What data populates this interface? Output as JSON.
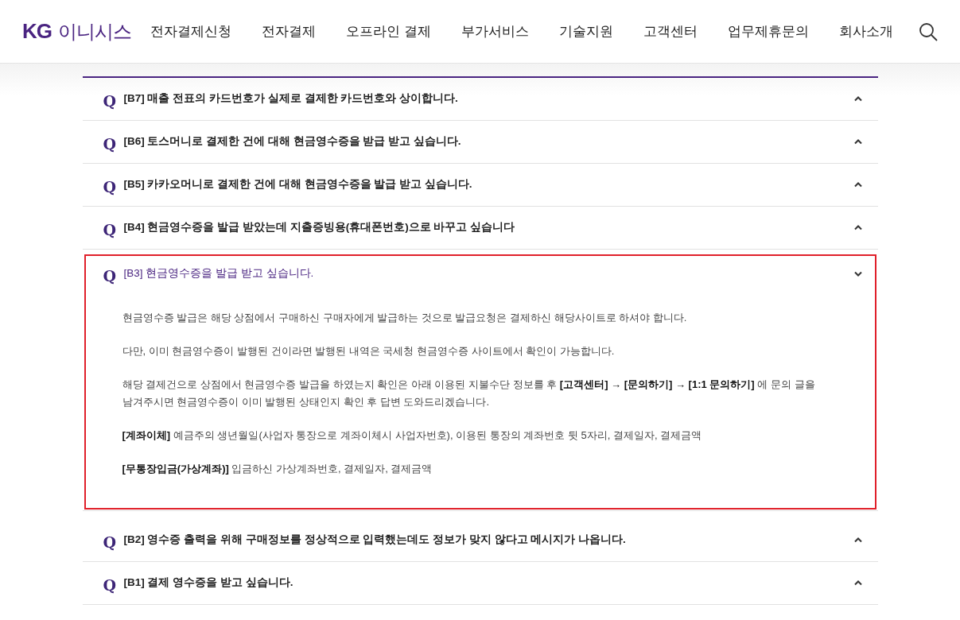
{
  "header": {
    "logo": {
      "mark": "KG",
      "name": "이니시스"
    },
    "nav": [
      "전자결제신청",
      "전자결제",
      "오프라인 결제",
      "부가서비스",
      "기술지원",
      "고객센터",
      "업무제휴문의",
      "회사소개"
    ]
  },
  "faq": [
    {
      "q": "Q",
      "title": "[B7] 매출 전표의 카드번호가 실제로 결제한 카드번호와 상이합니다.",
      "expanded": false
    },
    {
      "q": "Q",
      "title": "[B6] 토스머니로 결제한 건에 대해 현금영수증을 받급 받고 싶습니다.",
      "expanded": false
    },
    {
      "q": "Q",
      "title": "[B5] 카카오머니로 결제한 건에 대해 현금영수증을 발급 받고 싶습니다.",
      "expanded": false
    },
    {
      "q": "Q",
      "title": "[B4] 현금영수증을 발급 받았는데 지출증빙용(휴대폰번호)으로 바꾸고 싶습니다",
      "expanded": false
    },
    {
      "q": "Q",
      "title": "[B3] 현금영수증을 발급 받고 싶습니다.",
      "expanded": true,
      "answer": [
        "현금영수증 발급은 해당 상점에서 구매하신 구매자에게 발급하는 것으로 발급요청은 결제하신 해당사이트로 하셔야 합니다.",
        "다만, 이미 현금영수증이 발행된 건이라면 발행된 내역은 국세청 현금영수증 사이트에서 확인이 가능합니다.",
        "해당 결제건으로 상점에서 현금영수증 발급을 하였는지 확인은 아래 이용된 지불수단 정보를 후 **[고객센터] → [문의하기] → [1:1 문의하기]** 에 문의 글을 남겨주시면 현금영수증이 이미 발행된 상태인지 확인 후 답변 도와드리겠습니다.",
        "**[계좌이체]** 예금주의 생년월일(사업자 통장으로 계좌이체시 사업자번호), 이용된 통장의 계좌번호 뒷 5자리, 결제일자, 결제금액",
        "**[무통장입금(가상계좌)]** 입금하신 가상계좌번호, 결제일자, 결제금액"
      ]
    },
    {
      "q": "Q",
      "title": "[B2] 영수증 출력을 위해 구매정보를 정상적으로 입력했는데도 정보가 맞지 않다고 메시지가 나옵니다.",
      "expanded": false
    },
    {
      "q": "Q",
      "title": "[B1] 결제 영수증을 받고 싶습니다.",
      "expanded": false
    }
  ]
}
